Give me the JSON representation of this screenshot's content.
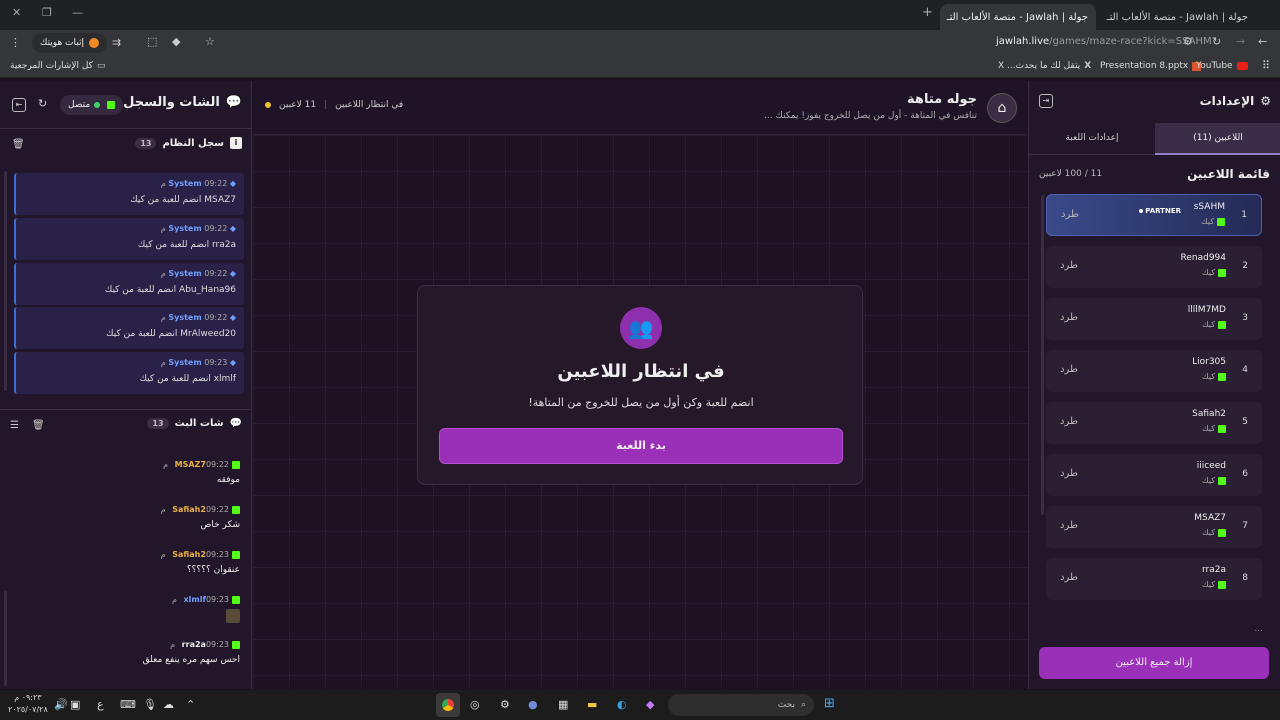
{
  "browser": {
    "tabs": [
      {
        "label": "جولة | Jawlah - منصة الألعاب التـ",
        "active": true
      },
      {
        "label": "جولة | Jawlah - منصة الألعاب التـ",
        "active": false
      }
    ],
    "new_tab": "+",
    "url_domain": "jawlah.live",
    "url_path": "/games/maze-race?kick=SSAHM",
    "profile_label": "إثبات هويتك",
    "bookmarks": {
      "all": "كل الإشارات المرجعية",
      "youtube": "YouTube",
      "presentation": "Presentation 8.pptx",
      "x_item": "يتقل لك ما يحدث... X"
    }
  },
  "left": {
    "title": "الشات والسجل",
    "status": "متصل",
    "system_log_title": "سجل النظام",
    "system_log_count": "13",
    "system_messages": [
      {
        "sender": "System",
        "time": "09:22 م",
        "text": "MSAZ7 انضم للعبة من كيك"
      },
      {
        "sender": "System",
        "time": "09:22 م",
        "text": "rra2a انضم للعبة من كيك"
      },
      {
        "sender": "System",
        "time": "09:22 م",
        "text": "Abu_Hana96 انضم للعبة من كيك"
      },
      {
        "sender": "System",
        "time": "09:22 م",
        "text": "MrAlweed20 انضم للعبة من كيك"
      },
      {
        "sender": "System",
        "time": "09:23 م",
        "text": "xlmlf انضم للعبة من كيك"
      }
    ],
    "chat_title": "شات البث",
    "chat_count": "13",
    "chat_messages": [
      {
        "name": "MSAZ7",
        "time": "09:22 م",
        "text": "موفقه"
      },
      {
        "name": "Safiah2",
        "time": "09:22 م",
        "text": "شكر خاص"
      },
      {
        "name": "Safiah2",
        "time": "09:23 م",
        "text": "عنقوان ؟؟؟؟؟"
      },
      {
        "name": "xlmlf",
        "time": "09:23 م",
        "text": ""
      },
      {
        "name": "rra2a",
        "time": "09:23 م",
        "text": "احس سهم مره ينفع معلق"
      }
    ]
  },
  "center": {
    "game_title": "جوله متاهة",
    "game_subtitle": "تنافس في المتاهة - أول من يصل للخروج يفوز! يمكنك ...",
    "players_count": "11 لاعبين",
    "waiting_status": "في انتظار اللاعبين",
    "card_title": "في انتظار اللاعبين",
    "card_subtitle": "انضم للعبة وكن أول من يصل للخروج من المتاهة!",
    "start_button": "بدء اللعبة"
  },
  "right": {
    "title": "الإعدادات",
    "tab_players": "اللاعبين (11)",
    "tab_settings": "إعدادات اللعبة",
    "list_title": "قائمة اللاعبين",
    "list_count": "11 / 100 لاعبين",
    "kick_label": "طرد",
    "partner_badge": "PARTNER",
    "players": [
      {
        "rank": "1",
        "name": "sSAHM",
        "platform": "كيك"
      },
      {
        "rank": "2",
        "name": "Renad994",
        "platform": "كيك"
      },
      {
        "rank": "3",
        "name": "llllM7MD",
        "platform": "كيك"
      },
      {
        "rank": "4",
        "name": "Lior305",
        "platform": "كيك"
      },
      {
        "rank": "5",
        "name": "Safiah2",
        "platform": "كيك"
      },
      {
        "rank": "6",
        "name": "iiiceed",
        "platform": "كيك"
      },
      {
        "rank": "7",
        "name": "MSAZ7",
        "platform": "كيك"
      },
      {
        "rank": "8",
        "name": "rra2a",
        "platform": "كيك"
      }
    ],
    "remove_all": "إزالة جميع اللاعبين"
  },
  "taskbar": {
    "search_placeholder": "بحث",
    "time": "٠٩:٢٣ م",
    "date": "٢٠٢٥/٠٧/٢٨",
    "lang": "ع"
  },
  "colors": {
    "accent": "#9b30b8",
    "kick": "#53fc18",
    "system": "#6fa0ff"
  }
}
